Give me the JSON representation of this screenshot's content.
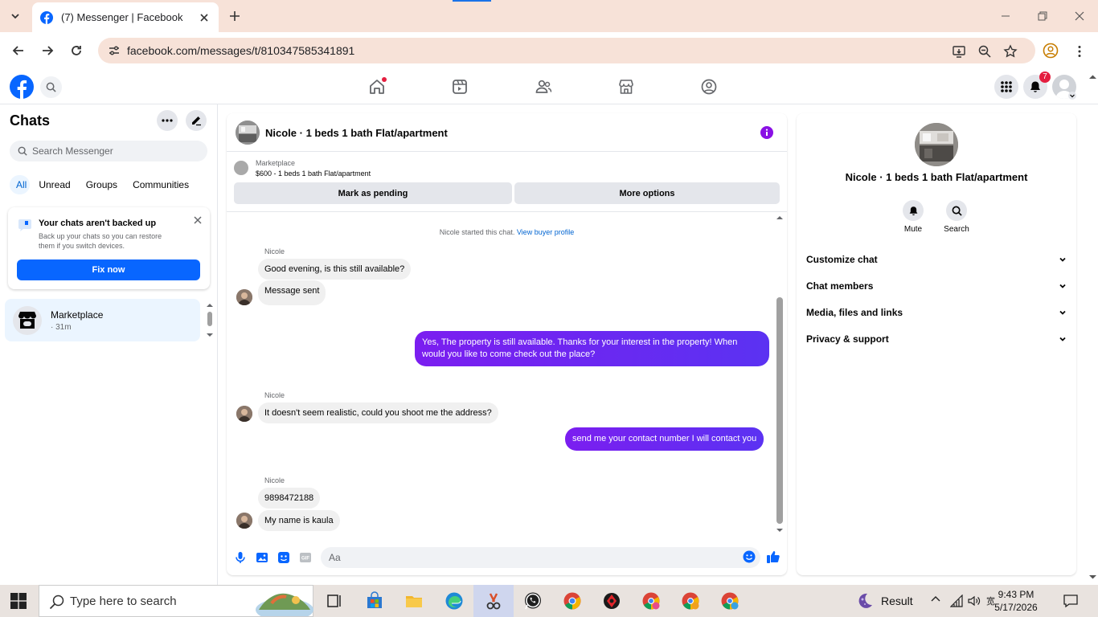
{
  "browser": {
    "tab_title": "(7) Messenger | Facebook",
    "url": "facebook.com/messages/t/810347585341891"
  },
  "fb": {
    "notification_count": "7"
  },
  "sidebar": {
    "title": "Chats",
    "search_placeholder": "Search Messenger",
    "filters": [
      "All",
      "Unread",
      "Groups",
      "Communities"
    ],
    "backup": {
      "title": "Your chats aren't backed up",
      "desc": "Back up your chats so you can restore them if you switch devices.",
      "button": "Fix now"
    },
    "conversations": [
      {
        "name": "Marketplace",
        "time": "· 31m"
      }
    ]
  },
  "chat": {
    "title": "Nicole · 1 beds 1 bath Flat/apartment",
    "marketplace_label": "Marketplace",
    "listing": "$600 - 1 beds 1 bath Flat/apartment",
    "mark_pending": "Mark as pending",
    "more_options": "More options",
    "system_text": "Nicole started this chat.",
    "system_link": "View buyer profile",
    "sender_name": "Nicole",
    "messages": [
      "Good evening, is this still available?",
      "Message sent",
      "Yes, The property is still available. Thanks for your interest in the property! When would you like to come check out the place?",
      "It doesn't seem realistic, could you shoot me the address?",
      "send me your contact number I will contact you",
      "9898472188",
      "My name is kaula"
    ],
    "composer_placeholder": "Aa",
    "accent_color": "#6b29f4"
  },
  "details": {
    "name": "Nicole · 1 beds 1 bath Flat/apartment",
    "actions": [
      "Mute",
      "Search"
    ],
    "sections": [
      "Customize chat",
      "Chat members",
      "Media, files and links",
      "Privacy & support"
    ]
  },
  "taskbar": {
    "search_placeholder": "Type here to search",
    "weather": "Result",
    "time": "9:43 PM",
    "date": "5/17/2026"
  }
}
